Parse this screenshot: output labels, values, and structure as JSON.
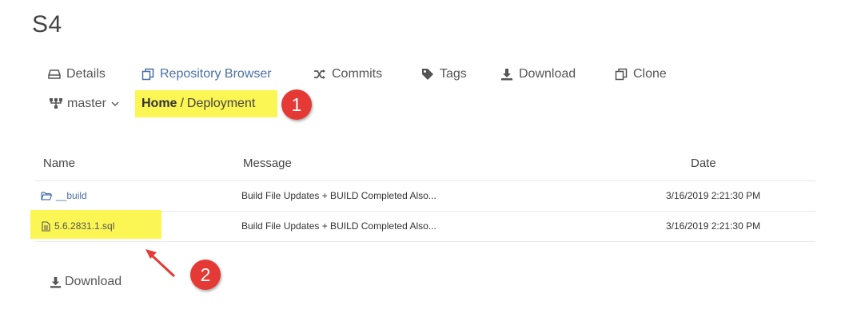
{
  "repo": {
    "title": "S4"
  },
  "tabs": [
    {
      "label": "Details",
      "icon": "drive-icon"
    },
    {
      "label": "Repository Browser",
      "icon": "copy-icon",
      "active": true
    },
    {
      "label": "Commits",
      "icon": "shuffle-icon"
    },
    {
      "label": "Tags",
      "icon": "tag-icon"
    },
    {
      "label": "Download",
      "icon": "download-icon"
    },
    {
      "label": "Clone",
      "icon": "clone-icon"
    }
  ],
  "branch": {
    "label": "master"
  },
  "breadcrumb": {
    "home": "Home",
    "separator": "/",
    "current": "Deployment"
  },
  "annotations": {
    "badge1": "1",
    "badge2": "2",
    "badge_color": "#e53935",
    "highlight_color": "#fbf653"
  },
  "table": {
    "headers": {
      "name": "Name",
      "message": "Message",
      "date": "Date"
    },
    "rows": [
      {
        "type": "folder",
        "name": "__build",
        "message": "Build File Updates + BUILD Completed Also...",
        "date": "3/16/2019 2:21:30 PM"
      },
      {
        "type": "file",
        "name": "5.6.2831.1.sql",
        "message": "Build File Updates + BUILD Completed Also...",
        "date": "3/16/2019 2:21:30 PM"
      }
    ]
  },
  "footer": {
    "download_label": "Download"
  },
  "colors": {
    "link": "#4a6fa5",
    "text": "#555555"
  }
}
